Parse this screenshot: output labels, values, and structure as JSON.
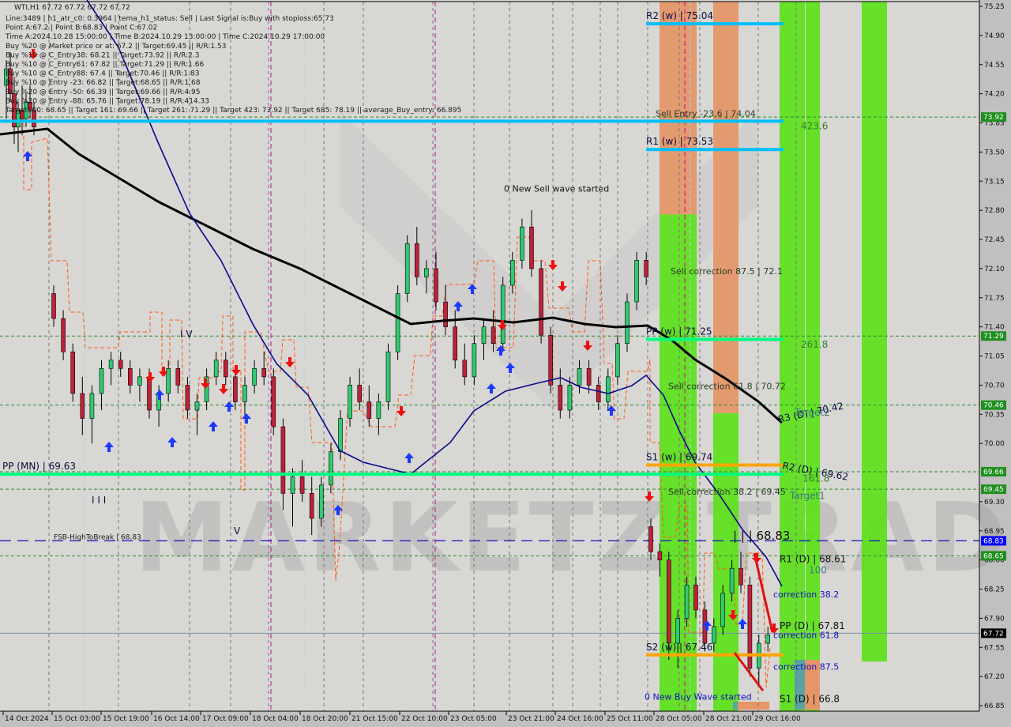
{
  "window": {
    "symbol_line": "WTI,H1  67.72 67.72 67.72 67.72"
  },
  "info_lines": [
    "Line:3489 | h1_atr_c0: 0.3964 | tema_h1_status: Sell | Last Signal is:Buy with stoploss:65.73",
    "Point A:67.2 | Point B:68.83 | Point C:67.02",
    "Time A:2024.10.28 15:00:00 | Time B:2024.10.29 13:00:00 | Time C:2024.10.29 17:00:00",
    "Buy %20 @ Market price or at: 67.2 || Target:69.45 || R/R:1.53",
    "Buy %10 @ C_Entry38: 68.21 || Target:73.92 || R/R:2.3",
    "Buy %10 @ C_Entry61: 67.82 || Target:71.29 || R/R:1.66",
    "Buy %10 @ C_Entry88: 67.4 || Target:70.46 || R/R:1.83",
    "Buy %10 @ Entry -23: 66.82 || Target:68.65 || R/R:1.68",
    "Buy %20 @ Entry -50: 66.39 || Target:69.66 || R/R:4.95",
    "Buy %20 @ Entry -88: 65.76 || Target:78.19 || R/R:414.33",
    "Target100: 68.65 || Target 161: 69.66 || Target 261: 71.29 || Target 423: 73.92 || Target 685: 78.19 || average_Buy_entry: 66.895"
  ],
  "watermark": "MARKETZITRADE",
  "colors": {
    "background": "#d8d7d4",
    "axis_bg": "#c0c0c0",
    "bull": "#2ecc71",
    "bear": "#c0213a",
    "pivot_blue": "#00bfff",
    "pivot_green": "#00ff80",
    "pivot_orange": "#ffa500",
    "zone_green": "#5de11a",
    "zone_orange": "#e59566",
    "zone_teal": "#5aa3a3",
    "tag_green": "#1f8f1f",
    "tag_blue": "#0000ff",
    "tag_black": "#000000",
    "ma_black": "#000000",
    "ma_navy": "#0a0a8a",
    "envelope": "#ff5a14"
  },
  "chart_data": {
    "type": "candlestick",
    "title": "WTI,H1",
    "ylim": [
      66.85,
      75.25
    ],
    "y_ticks": [
      "75.25",
      "74.90",
      "74.55",
      "74.20",
      "73.85",
      "73.50",
      "73.15",
      "72.80",
      "72.45",
      "72.10",
      "71.75",
      "71.40",
      "71.05",
      "70.70",
      "70.35",
      "70.00",
      "69.30",
      "68.95",
      "68.60",
      "68.25",
      "67.90",
      "67.55",
      "67.20",
      "66.85"
    ],
    "x_ticks": [
      "14 Oct 2024",
      "15 Oct 03:00",
      "15 Oct 19:00",
      "16 Oct 14:00",
      "17 Oct 09:00",
      "18 Oct 04:00",
      "18 Oct 20:00",
      "21 Oct 15:00",
      "22 Oct 10:00",
      "23 Oct 05:00",
      "23 Oct 21:00",
      "24 Oct 16:00",
      "25 Oct 11:00",
      "28 Oct 05:00",
      "28 Oct 21:00",
      "29 Oct 16:00"
    ],
    "price_tags": [
      {
        "value": "73.92",
        "kind": "green"
      },
      {
        "value": "71.29",
        "kind": "green"
      },
      {
        "value": "70.46",
        "kind": "green"
      },
      {
        "value": "69.66",
        "kind": "green"
      },
      {
        "value": "69.45",
        "kind": "green"
      },
      {
        "value": "68.83",
        "kind": "blue"
      },
      {
        "value": "68.65",
        "kind": "green"
      },
      {
        "value": "67.72",
        "kind": "black"
      }
    ],
    "horizontal_levels": [
      {
        "label": "R2 (w) | 75.04",
        "price": 75.04,
        "color": "blue"
      },
      {
        "label": "Sell Entry -23.6 | 74.04",
        "price": 73.87,
        "color": "blue-long"
      },
      {
        "label": "R1 (w) | 73.53",
        "price": 73.53,
        "color": "blue"
      },
      {
        "label": "PP (w) | 71.25",
        "price": 71.25,
        "color": "green"
      },
      {
        "label": "S1 (w) | 69.74",
        "price": 69.74,
        "color": "orange"
      },
      {
        "label": "PP (MN) | 69.63",
        "price": 69.63,
        "color": "green-long"
      },
      {
        "label": "S2 (w) | 67.46",
        "price": 67.46,
        "color": "orange"
      }
    ],
    "dashed_levels": [
      73.92,
      71.29,
      70.46,
      69.66,
      69.45,
      68.65
    ],
    "fsb_line": {
      "label": "FSB-HighToBreak | 68.83",
      "price": 68.83
    },
    "annotations": [
      {
        "text": "0 New Sell wave started",
        "price": 73.06,
        "at": "23 Oct 05:00"
      },
      {
        "text": "Sell correction 87.5 | 72.1",
        "price": 72.07
      },
      {
        "text": "Sell correction 61.8 | 70.72",
        "price": 70.69
      },
      {
        "text": "Sell correction 38.2 | 69.45",
        "price": 69.42
      },
      {
        "text": "| | | 68.83",
        "price": 68.88
      },
      {
        "text": "R3 (D) | 70.42",
        "price": 70.42
      },
      {
        "text": "R2 (D) | 69.62",
        "price": 69.62
      },
      {
        "text": "R1 (D) | 68.61",
        "price": 68.61
      },
      {
        "text": "PP (D) | 67.81",
        "price": 67.81
      },
      {
        "text": "S1 (D) | 66.8",
        "price": 66.93
      },
      {
        "text": "correction 38.2",
        "price": 68.19
      },
      {
        "text": "correction 61.8",
        "price": 67.7
      },
      {
        "text": "correction 87.5",
        "price": 67.32
      },
      {
        "text": "0 New Buy Wave started",
        "price": 66.96
      },
      {
        "text": "423.6",
        "price": 73.81
      },
      {
        "text": "261.8",
        "price": 71.19
      },
      {
        "text": "Target2",
        "price": 70.37
      },
      {
        "text": "161.8",
        "price": 69.58
      },
      {
        "text": "Target1",
        "price": 69.37
      },
      {
        "text": "100",
        "price": 68.48
      }
    ],
    "wave_labels": [
      "I V",
      "I I I",
      "V"
    ],
    "candles": [
      [
        74.3,
        74.6,
        73.9,
        74.5
      ],
      [
        74.5,
        74.7,
        74.1,
        74.2
      ],
      [
        74.2,
        74.4,
        73.6,
        73.8
      ],
      [
        73.8,
        74.1,
        73.5,
        74.0
      ],
      [
        74.0,
        74.3,
        73.7,
        73.9
      ],
      [
        73.9,
        74.2,
        73.8,
        74.1
      ],
      [
        74.1,
        74.3,
        73.9,
        74.0
      ],
      [
        74.0,
        74.1,
        73.7,
        73.8
      ],
      [
        71.8,
        71.9,
        71.4,
        71.5
      ],
      [
        71.5,
        71.6,
        71.0,
        71.1
      ],
      [
        71.1,
        71.2,
        70.5,
        70.6
      ],
      [
        70.6,
        70.8,
        70.1,
        70.3
      ],
      [
        70.3,
        70.7,
        70.0,
        70.6
      ],
      [
        70.6,
        71.0,
        70.4,
        70.9
      ],
      [
        70.9,
        71.1,
        70.7,
        71.0
      ],
      [
        71.0,
        71.1,
        70.8,
        70.9
      ],
      [
        70.9,
        71.0,
        70.6,
        70.7
      ],
      [
        70.7,
        70.9,
        70.5,
        70.8
      ],
      [
        70.8,
        70.9,
        70.3,
        70.4
      ],
      [
        70.4,
        70.7,
        70.2,
        70.6
      ],
      [
        70.6,
        71.0,
        70.5,
        70.9
      ],
      [
        70.9,
        71.0,
        70.6,
        70.7
      ],
      [
        70.7,
        70.8,
        70.3,
        70.4
      ],
      [
        70.4,
        70.6,
        70.1,
        70.5
      ],
      [
        70.5,
        70.9,
        70.4,
        70.8
      ],
      [
        70.8,
        71.1,
        70.7,
        71.0
      ],
      [
        71.0,
        71.1,
        70.7,
        70.8
      ],
      [
        70.8,
        70.9,
        70.4,
        70.5
      ],
      [
        70.5,
        70.8,
        70.3,
        70.7
      ],
      [
        70.7,
        71.0,
        70.6,
        70.9
      ],
      [
        70.9,
        71.1,
        70.7,
        70.8
      ],
      [
        70.8,
        70.9,
        70.1,
        70.2
      ],
      [
        70.2,
        70.3,
        69.2,
        69.4
      ],
      [
        69.4,
        69.7,
        69.0,
        69.6
      ],
      [
        69.6,
        69.8,
        69.3,
        69.4
      ],
      [
        69.4,
        69.6,
        68.9,
        69.1
      ],
      [
        69.1,
        69.6,
        69.0,
        69.5
      ],
      [
        69.5,
        70.0,
        69.4,
        69.9
      ],
      [
        69.9,
        70.4,
        69.8,
        70.3
      ],
      [
        70.3,
        70.8,
        70.2,
        70.7
      ],
      [
        70.7,
        70.9,
        70.4,
        70.5
      ],
      [
        70.5,
        70.7,
        70.2,
        70.3
      ],
      [
        70.3,
        70.6,
        70.1,
        70.5
      ],
      [
        70.5,
        71.2,
        70.4,
        71.1
      ],
      [
        71.1,
        71.9,
        71.0,
        71.8
      ],
      [
        71.8,
        72.5,
        71.7,
        72.4
      ],
      [
        72.4,
        72.6,
        71.9,
        72.0
      ],
      [
        72.0,
        72.2,
        71.8,
        72.1
      ],
      [
        72.1,
        72.3,
        71.6,
        71.7
      ],
      [
        71.7,
        71.9,
        71.3,
        71.4
      ],
      [
        71.4,
        71.6,
        70.9,
        71.0
      ],
      [
        71.0,
        71.2,
        70.7,
        70.8
      ],
      [
        70.8,
        71.3,
        70.7,
        71.2
      ],
      [
        71.2,
        71.5,
        71.0,
        71.4
      ],
      [
        71.4,
        71.6,
        71.1,
        71.2
      ],
      [
        71.2,
        72.0,
        71.1,
        71.9
      ],
      [
        71.9,
        72.3,
        71.8,
        72.2
      ],
      [
        72.2,
        72.7,
        72.1,
        72.6
      ],
      [
        72.6,
        72.8,
        72.0,
        72.1
      ],
      [
        72.1,
        72.2,
        71.2,
        71.3
      ],
      [
        71.3,
        71.4,
        70.6,
        70.7
      ],
      [
        70.7,
        70.9,
        70.3,
        70.4
      ],
      [
        70.4,
        70.8,
        70.3,
        70.7
      ],
      [
        70.7,
        71.0,
        70.6,
        70.9
      ],
      [
        70.9,
        71.0,
        70.6,
        70.7
      ],
      [
        70.7,
        70.8,
        70.4,
        70.5
      ],
      [
        70.5,
        70.9,
        70.4,
        70.8
      ],
      [
        70.8,
        71.3,
        70.7,
        71.2
      ],
      [
        71.2,
        71.8,
        71.1,
        71.7
      ],
      [
        71.7,
        72.3,
        71.6,
        72.2
      ],
      [
        72.2,
        72.3,
        71.9,
        72.0
      ],
      [
        69.0,
        69.1,
        68.6,
        68.7
      ],
      [
        68.7,
        68.8,
        68.4,
        68.6
      ],
      [
        68.6,
        68.7,
        67.4,
        67.6
      ],
      [
        67.6,
        68.0,
        67.3,
        67.9
      ],
      [
        67.9,
        68.4,
        67.8,
        68.3
      ],
      [
        68.3,
        68.4,
        67.9,
        68.0
      ],
      [
        68.0,
        68.1,
        67.5,
        67.6
      ],
      [
        67.6,
        67.9,
        67.5,
        67.8
      ],
      [
        67.8,
        68.3,
        67.7,
        68.2
      ],
      [
        68.2,
        68.6,
        68.1,
        68.5
      ],
      [
        68.5,
        68.7,
        68.2,
        68.3
      ],
      [
        68.3,
        68.4,
        67.2,
        67.3
      ],
      [
        67.3,
        67.7,
        67.1,
        67.6
      ],
      [
        67.6,
        67.8,
        67.5,
        67.7
      ]
    ],
    "zones": [
      {
        "color": "orange",
        "from": 0.0,
        "to": 0.3,
        "col": 0
      },
      {
        "color": "green",
        "from": 0.3,
        "to": 1.0,
        "col": 0
      },
      {
        "color": "orange",
        "from": 0.0,
        "to": 0.58,
        "col": 1
      },
      {
        "color": "green",
        "from": 0.58,
        "to": 1.0,
        "col": 1
      },
      {
        "color": "green",
        "from": 0.0,
        "to": 1.0,
        "col": 2
      },
      {
        "color": "green",
        "from": 0.0,
        "to": 0.93,
        "col": 3
      },
      {
        "color": "green",
        "from": 0.0,
        "to": 1.0,
        "col": 4
      }
    ]
  }
}
